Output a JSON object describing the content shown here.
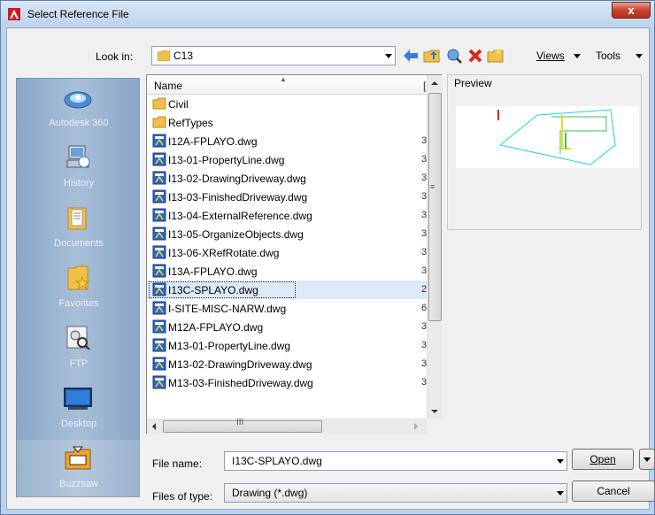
{
  "window": {
    "title": "Select Reference File",
    "close_label": "x"
  },
  "toolbar": {
    "lookin_label": "Look in:",
    "lookin_value": "C13",
    "views_label": "Views",
    "tools_label": "Tools"
  },
  "places": [
    {
      "label": "Autodesk 360",
      "icon": "cloud-icon"
    },
    {
      "label": "History",
      "icon": "history-icon"
    },
    {
      "label": "Documents",
      "icon": "documents-icon"
    },
    {
      "label": "Favorites",
      "icon": "favorites-icon"
    },
    {
      "label": "FTP",
      "icon": "ftp-icon"
    },
    {
      "label": "Desktop",
      "icon": "desktop-icon"
    },
    {
      "label": "Buzzsaw",
      "icon": "buzzsaw-icon"
    }
  ],
  "filelist": {
    "column_name": "Name",
    "column_trunc": "[",
    "files": [
      {
        "name": "Civil",
        "type": "folder",
        "col2": ""
      },
      {
        "name": "RefTypes",
        "type": "folder",
        "col2": ""
      },
      {
        "name": "I12A-FPLAYO.dwg",
        "type": "dwg",
        "col2": "3"
      },
      {
        "name": "I13-01-PropertyLine.dwg",
        "type": "dwg",
        "col2": "3"
      },
      {
        "name": "I13-02-DrawingDriveway.dwg",
        "type": "dwg",
        "col2": "3"
      },
      {
        "name": "I13-03-FinishedDriveway.dwg",
        "type": "dwg",
        "col2": "3"
      },
      {
        "name": "I13-04-ExternalReference.dwg",
        "type": "dwg",
        "col2": "3"
      },
      {
        "name": "I13-05-OrganizeObjects.dwg",
        "type": "dwg",
        "col2": "3"
      },
      {
        "name": "I13-06-XRefRotate.dwg",
        "type": "dwg",
        "col2": "3"
      },
      {
        "name": "I13A-FPLAYO.dwg",
        "type": "dwg",
        "col2": "3"
      },
      {
        "name": "I13C-SPLAYO.dwg",
        "type": "dwg",
        "col2": "2"
      },
      {
        "name": "I-SITE-MISC-NARW.dwg",
        "type": "dwg",
        "col2": "6"
      },
      {
        "name": "M12A-FPLAYO.dwg",
        "type": "dwg",
        "col2": "3"
      },
      {
        "name": "M13-01-PropertyLine.dwg",
        "type": "dwg",
        "col2": "3"
      },
      {
        "name": "M13-02-DrawingDriveway.dwg",
        "type": "dwg",
        "col2": "3"
      },
      {
        "name": "M13-03-FinishedDriveway.dwg",
        "type": "dwg",
        "col2": "3"
      }
    ],
    "scroll_grip": "≡",
    "hscroll_grip": "III"
  },
  "preview": {
    "label": "Preview"
  },
  "bottom": {
    "filename_label": "File name:",
    "filename_value": "I13C-SPLAYO.dwg",
    "filetype_label": "Files of type:",
    "filetype_value": "Drawing (*.dwg)",
    "open_label": "Open",
    "cancel_label": "Cancel"
  },
  "colors": {
    "accent": "#3399ff",
    "places_bg": "#9cb5d2",
    "selection": "#dbe9f9"
  }
}
